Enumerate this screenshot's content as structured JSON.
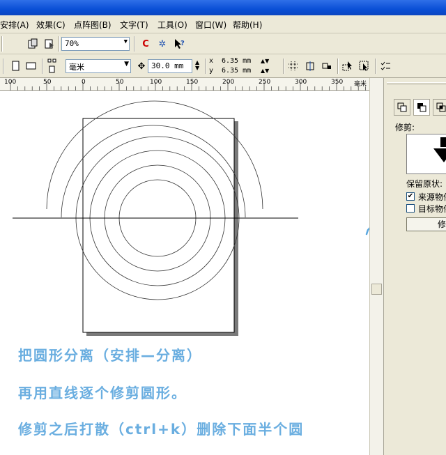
{
  "menu": {
    "items": [
      "安排(A)",
      "效果(C)",
      "点阵图(B)",
      "文字(T)",
      "工具(O)",
      "窗口(W)",
      "帮助(H)"
    ]
  },
  "toolbar": {
    "zoom_value": "70%"
  },
  "propbar": {
    "unit_value": "毫米",
    "nudge_value": "30.0 mm",
    "dup_x_label": "x",
    "dup_y_label": "y",
    "dup_x_value": "6.35 mm",
    "dup_y_value": "6.35 mm"
  },
  "ruler": {
    "ticks": [
      "100",
      "50",
      "0",
      "50",
      "100",
      "150",
      "200",
      "250",
      "300",
      "350"
    ],
    "unit": "毫米"
  },
  "docker": {
    "trim_label": "修剪:",
    "keep_label": "保留原状:",
    "source_label": "来源物件",
    "target_label": "目标物件",
    "source_checked": true,
    "target_checked": false,
    "apply_label": "修剪"
  },
  "notes": {
    "line1": "把圆形分离（安排—分离）",
    "line2": "再用直线逐个修剪圆形。",
    "line3": "修剪之后打散（ctrl+k）删除下面半个圆"
  },
  "colors": {
    "note_text": "#6aaee0",
    "arrow": "#5aa8e0",
    "ui_bg": "#ece9d8"
  }
}
